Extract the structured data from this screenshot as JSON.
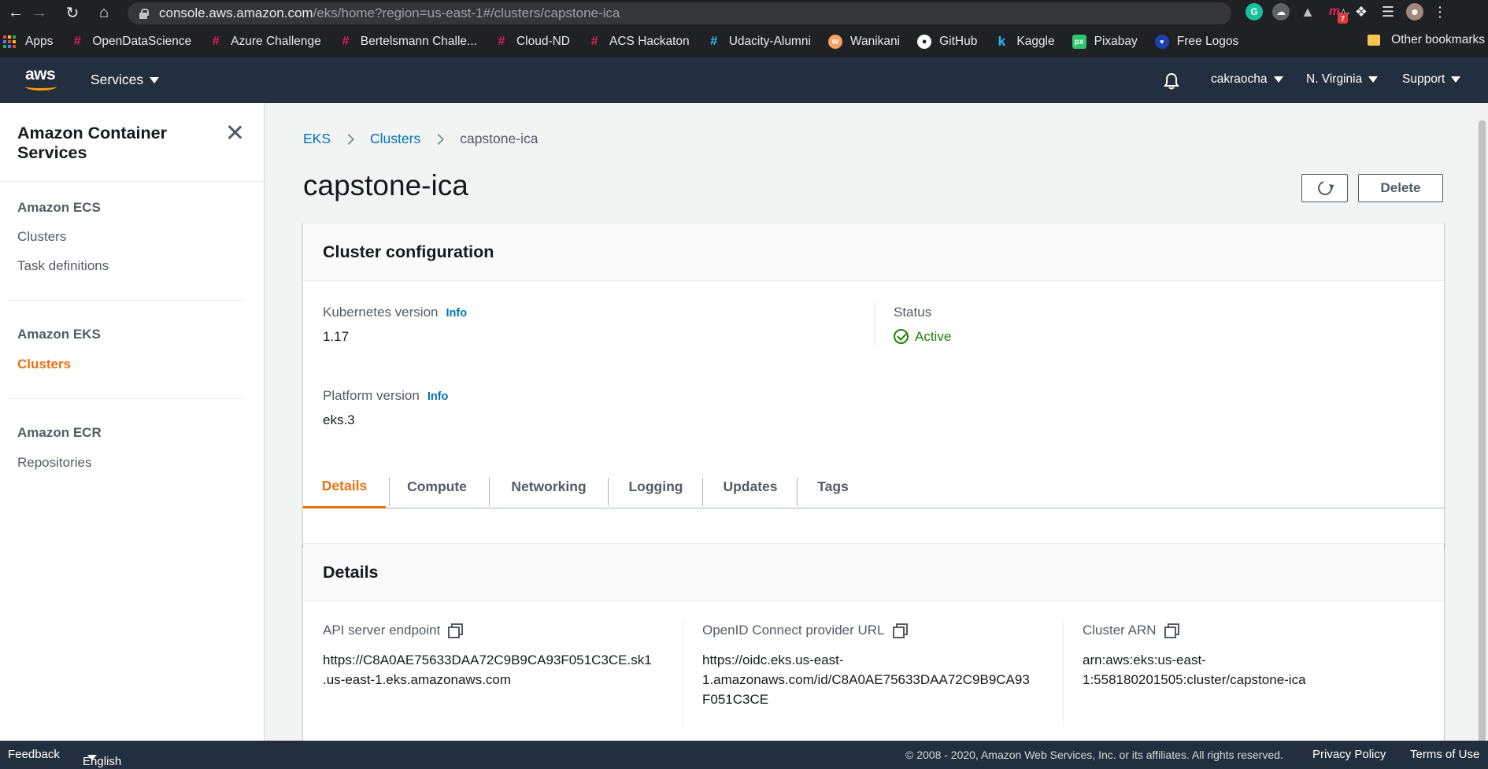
{
  "browser": {
    "url_host": "console.aws.amazon.com",
    "url_path": "/eks/home?region=us-east-1#/clusters/capstone-ica",
    "bookmarks": [
      {
        "label": "Apps",
        "icon": "apps-grid-icon",
        "color": "#ffffff"
      },
      {
        "label": "OpenDataScience",
        "icon": "slack-icon",
        "color": "#e01e5a"
      },
      {
        "label": "Azure Challenge",
        "icon": "slack-icon",
        "color": "#e01e5a"
      },
      {
        "label": "Bertelsmann Challe...",
        "icon": "slack-icon",
        "color": "#e01e5a"
      },
      {
        "label": "Cloud-ND",
        "icon": "slack-icon",
        "color": "#e01e5a"
      },
      {
        "label": "ACS Hackaton",
        "icon": "slack-icon",
        "color": "#e01e5a"
      },
      {
        "label": "Udacity-Alumni",
        "icon": "slack-icon",
        "color": "#36c5f0"
      },
      {
        "label": "Wanikani",
        "icon": "wanikani-icon",
        "color": "#f4a261"
      },
      {
        "label": "GitHub",
        "icon": "github-icon",
        "color": "#ffffff"
      },
      {
        "label": "Kaggle",
        "icon": "kaggle-icon",
        "color": "#20beff"
      },
      {
        "label": "Pixabay",
        "icon": "pixabay-icon",
        "color": "#2ec66d"
      },
      {
        "label": "Free Logos",
        "icon": "heart-icon",
        "color": "#1e40af"
      }
    ],
    "other_bookmarks": "Other bookmarks",
    "extension_badge": "7"
  },
  "aws_nav": {
    "logo_text": "aws",
    "services": "Services",
    "user": "cakraocha",
    "region": "N. Virginia",
    "support": "Support"
  },
  "sidebar": {
    "title": "Amazon Container Services",
    "sections": [
      {
        "heading": "Amazon ECS",
        "items": [
          "Clusters",
          "Task definitions"
        ]
      },
      {
        "heading": "Amazon EKS",
        "items": [
          "Clusters"
        ]
      },
      {
        "heading": "Amazon ECR",
        "items": [
          "Repositories"
        ]
      }
    ]
  },
  "breadcrumb": [
    "EKS",
    "Clusters",
    "capstone-ica"
  ],
  "page_title": "capstone-ica",
  "buttons": {
    "delete": "Delete"
  },
  "cluster_config": {
    "title": "Cluster configuration",
    "k8s_label": "Kubernetes version",
    "k8s_value": "1.17",
    "platform_label": "Platform version",
    "platform_value": "eks.3",
    "info": "Info",
    "status_label": "Status",
    "status_value": "Active"
  },
  "tabs": [
    "Details",
    "Compute",
    "Networking",
    "Logging",
    "Updates",
    "Tags"
  ],
  "details": {
    "title": "Details",
    "api_label": "API server endpoint",
    "api_value_1": "https://C8A0AE75633DAA72C9B9CA93F051C3CE.sk1",
    "api_value_2": ".us-east-1.eks.amazonaws.com",
    "oidc_label": "OpenID Connect provider URL",
    "oidc_value_1": "https://oidc.eks.us-east-",
    "oidc_value_2": "1.amazonaws.com/id/C8A0AE75633DAA72C9B9CA93",
    "oidc_value_3": "F051C3CE",
    "arn_label": "Cluster ARN",
    "arn_value_1": "arn:aws:eks:us-east-",
    "arn_value_2": "1:558180201505:cluster/capstone-ica"
  },
  "footer": {
    "feedback": "Feedback",
    "language": "English (US)",
    "copyright": "© 2008 - 2020, Amazon Web Services, Inc. or its affiliates. All rights reserved.",
    "privacy": "Privacy Policy",
    "terms": "Terms of Use"
  },
  "colors": {
    "accent": "#ec7211",
    "link": "#0073bb",
    "nav_bg": "#232f3e",
    "success": "#1d8102"
  }
}
